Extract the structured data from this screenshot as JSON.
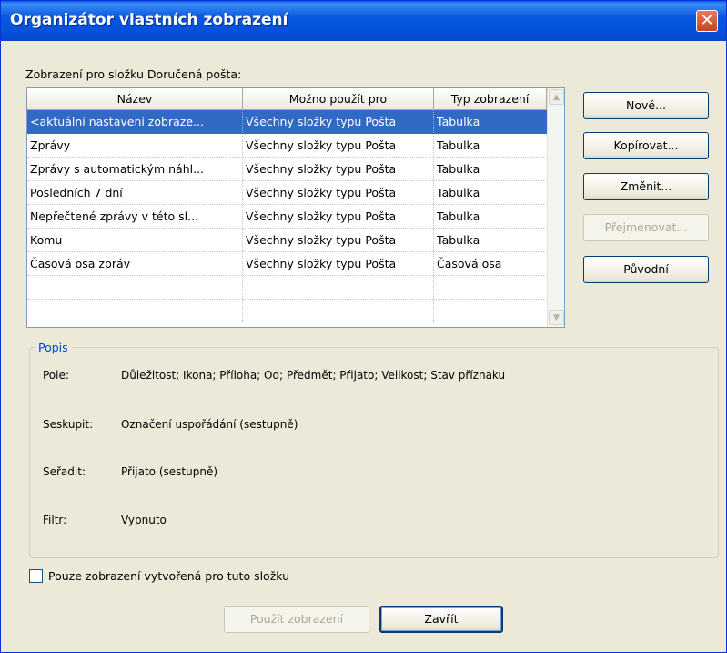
{
  "window": {
    "title": "Organizátor vlastních zobrazení",
    "close_symbol": "✕"
  },
  "views_label": "Zobrazení pro složku Doručená pošta:",
  "table": {
    "headers": [
      "Název",
      "Možno použít pro",
      "Typ zobrazení"
    ],
    "rows": [
      [
        "<aktuální nastavení zobraze...",
        "Všechny složky typu Pošta",
        "Tabulka"
      ],
      [
        "Zprávy",
        "Všechny složky typu Pošta",
        "Tabulka"
      ],
      [
        "Zprávy s automatickým náhl...",
        "Všechny složky typu Pošta",
        "Tabulka"
      ],
      [
        "Posledních 7 dní",
        "Všechny složky typu Pošta",
        "Tabulka"
      ],
      [
        "Nepřečtené zprávy v této sl...",
        "Všechny složky typu Pošta",
        "Tabulka"
      ],
      [
        "Komu",
        "Všechny složky typu Pošta",
        "Tabulka"
      ],
      [
        "Časová osa zpráv",
        "Všechny složky typu Pošta",
        "Časová osa"
      ]
    ],
    "selected_row": 0,
    "scroll_up_icon": "▲",
    "scroll_down_icon": "▼"
  },
  "buttons": {
    "new": "Nové...",
    "copy": "Kopírovat...",
    "modify": "Změnit...",
    "rename": "Přejmenovat...",
    "reset": "Původní",
    "apply": "Použít zobrazení",
    "close": "Zavřít"
  },
  "description": {
    "title": "Popis",
    "fields_label": "Pole:",
    "fields_value": "Důležitost; Ikona; Příloha; Od; Předmět; Přijato; Velikost; Stav příznaku",
    "group_label": "Seskupit:",
    "group_value": "Označení uspořádání (sestupně)",
    "sort_label": "Seřadit:",
    "sort_value": "Přijato (sestupně)",
    "filter_label": "Filtr:",
    "filter_value": "Vypnuto"
  },
  "only_this_folder": {
    "label": "Pouze zobrazení vytvořená pro tuto složku",
    "checked": false
  },
  "colors": {
    "title_bar": "#0858e0",
    "selection": "#316ac5",
    "dialog_bg": "#ece9d8",
    "group_title": "#0046d5"
  }
}
